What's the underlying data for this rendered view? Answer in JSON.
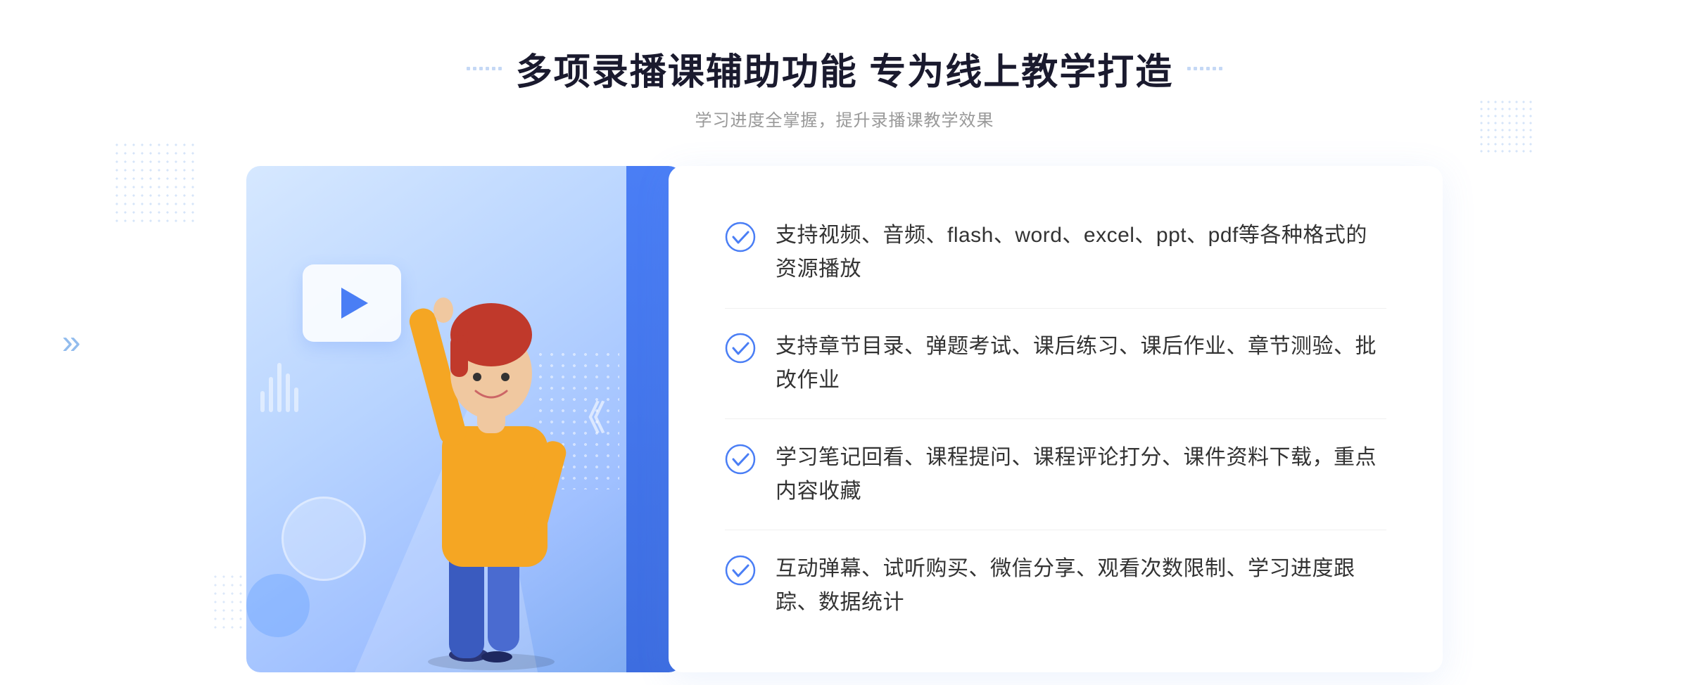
{
  "header": {
    "title": "多项录播课辅助功能 专为线上教学打造",
    "subtitle": "学习进度全掌握，提升录播课教学效果",
    "title_deco_left": "decorative-dots",
    "title_deco_right": "decorative-dots"
  },
  "features": [
    {
      "id": 1,
      "text": "支持视频、音频、flash、word、excel、ppt、pdf等各种格式的资源播放"
    },
    {
      "id": 2,
      "text": "支持章节目录、弹题考试、课后练习、课后作业、章节测验、批改作业"
    },
    {
      "id": 3,
      "text": "学习笔记回看、课程提问、课程评论打分、课件资料下载，重点内容收藏"
    },
    {
      "id": 4,
      "text": "互动弹幕、试听购买、微信分享、观看次数限制、学习进度跟踪、数据统计"
    }
  ],
  "icons": {
    "check": "check-circle-icon",
    "play": "play-icon",
    "arrow": "chevron-right-icon"
  },
  "colors": {
    "primary": "#4a7ef5",
    "title": "#1a1a2e",
    "subtitle": "#999999",
    "text": "#333333",
    "divider": "#f0f0f0",
    "illustration_bg_start": "#d6e8ff",
    "illustration_bg_end": "#7aa8f0",
    "blue_bar": "#4a7ef5"
  }
}
